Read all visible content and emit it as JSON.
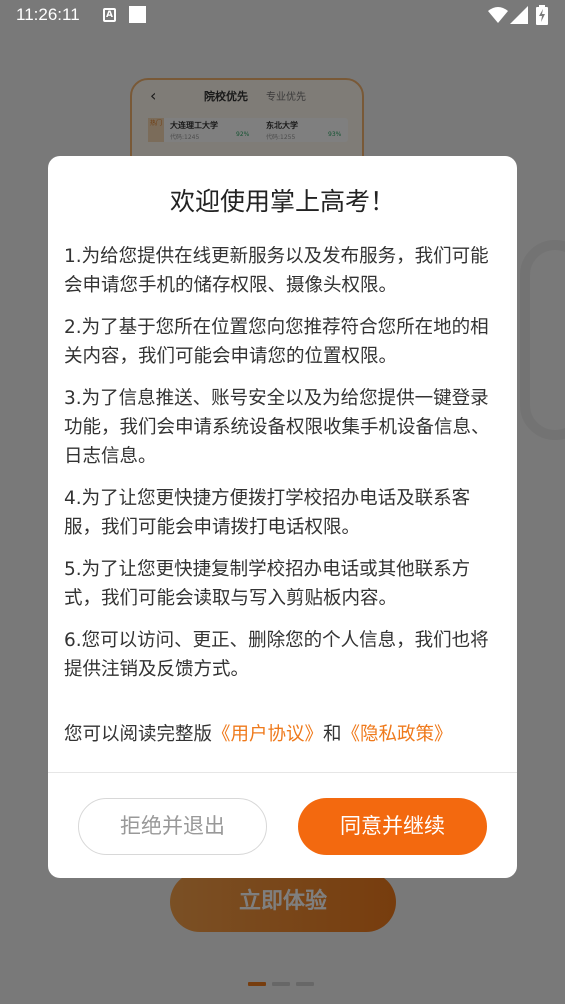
{
  "status_bar": {
    "time": "11:26:11",
    "sim_label": "A"
  },
  "background_page": {
    "card": {
      "tab_active": "院校优先",
      "tab_inactive": "专业优先",
      "tag": "热门",
      "school_1": "大连理工大学",
      "school_2": "东北大学",
      "code_1": "代码:1245",
      "code_2": "代码:1255",
      "prob_1": "92%",
      "prob_2": "93%"
    },
    "cta_label": "立即体验"
  },
  "dialog": {
    "title": "欢迎使用掌上高考！",
    "paragraphs": [
      "1.为给您提供在线更新服务以及发布服务，我们可能会申请您手机的储存权限、摄像头权限。",
      "2.为了基于您所在位置您向您推荐符合您所在地的相关内容，我们可能会申请您的位置权限。",
      "3.为了信息推送、账号安全以及为给您提供一键登录功能，我们会申请系统设备权限收集手机设备信息、日志信息。",
      "4.为了让您更快捷方便拨打学校招办电话及联系客服，我们可能会申请拨打电话权限。",
      "5.为了让您更快捷复制学校招办电话或其他联系方式，我们可能会读取与写入剪贴板内容。",
      "6.您可以访问、更正、删除您的个人信息，我们也将提供注销及反馈方式。"
    ],
    "read_prefix": "您可以阅读完整版",
    "user_agreement_link": "《用户协议》",
    "conjunction": "和",
    "privacy_policy_link": "《隐私政策》",
    "reject_button": "拒绝并退出",
    "accept_button": "同意并继续"
  },
  "colors": {
    "accent": "#f3690f",
    "link": "#ef7a1c",
    "overlay": "rgba(0,0,0,0.5)"
  }
}
